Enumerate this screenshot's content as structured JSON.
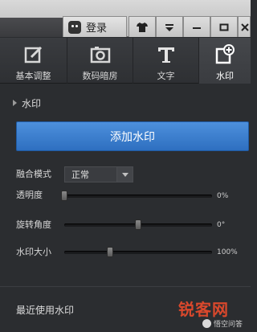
{
  "titlebar": {
    "login_label": "登录",
    "buttons": [
      "shirt-icon",
      "dropdown-icon",
      "minimize-icon",
      "maximize-icon",
      "close-icon"
    ]
  },
  "tabs": [
    {
      "label": "基本调整",
      "icon": "edit-square-icon"
    },
    {
      "label": "数码暗房",
      "icon": "camera-icon"
    },
    {
      "label": "文字",
      "icon": "text-icon"
    },
    {
      "label": "水印",
      "icon": "watermark-add-icon",
      "active": true
    }
  ],
  "panel": {
    "section_title": "水印",
    "add_button": "添加水印",
    "blend_mode_label": "融合模式",
    "blend_mode_value": "正常",
    "opacity_label": "透明度",
    "opacity_value": "0%",
    "opacity_level": 0,
    "rotation_label": "旋转角度",
    "rotation_value": "0°",
    "rotation_level": 0.5,
    "size_label": "水印大小",
    "size_value": "100%",
    "size_level": 0.31,
    "recent_label": "最近使用水印"
  },
  "watermark": {
    "site": "锐客网",
    "small": "悟空问答"
  },
  "colors": {
    "accent": "#3a7fd0",
    "panel_bg": "#2b2d30",
    "brand_red": "#d9482c"
  }
}
